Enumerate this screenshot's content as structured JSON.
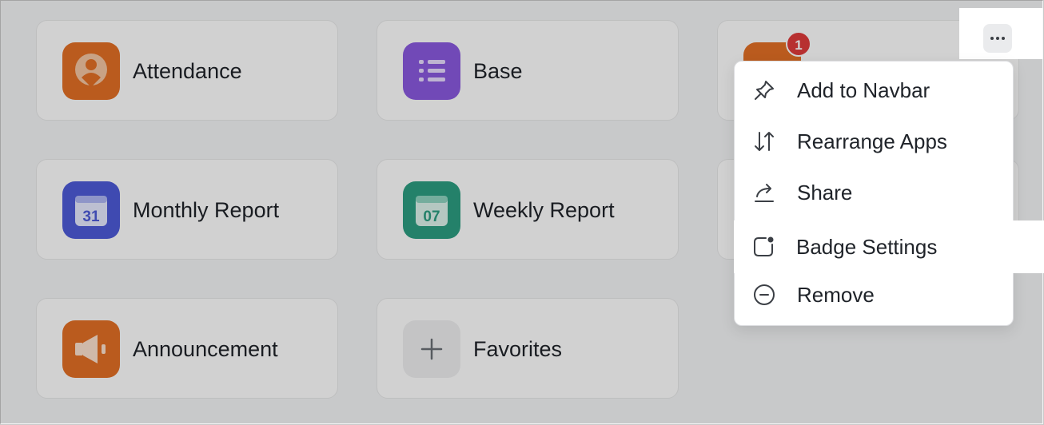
{
  "apps": [
    {
      "label": "Attendance",
      "icon": "attendance-icon",
      "color": "#e36f25"
    },
    {
      "label": "Base",
      "icon": "base-list-icon",
      "color": "#8a5ae0"
    },
    {
      "label": "Monthly Report",
      "icon": "calendar-31-icon",
      "icon_text": "31",
      "color": "#4e5bd8"
    },
    {
      "label": "Weekly Report",
      "icon": "calendar-07-icon",
      "icon_text": "07",
      "color": "#2d9e82"
    },
    {
      "label": "Announcement",
      "icon": "megaphone-icon",
      "color": "#e36f25"
    }
  ],
  "add_tile": {
    "label": "Favorites",
    "icon": "plus-icon"
  },
  "third_app": {
    "badge": "1",
    "color": "#e36f25"
  },
  "more_button": {
    "icon": "more-dots-icon"
  },
  "menu": {
    "items": [
      {
        "label": "Add to Navbar",
        "icon": "pin-icon"
      },
      {
        "label": "Rearrange Apps",
        "icon": "sort-arrows-icon"
      },
      {
        "label": "Share",
        "icon": "share-icon"
      },
      {
        "label": "Badge Settings",
        "icon": "badge-settings-icon"
      },
      {
        "label": "Remove",
        "icon": "remove-circle-icon"
      }
    ]
  },
  "colors": {
    "overlay": "rgba(0,0,0,0.18)",
    "badge": "#e03b3b",
    "text": "#1f2329"
  }
}
